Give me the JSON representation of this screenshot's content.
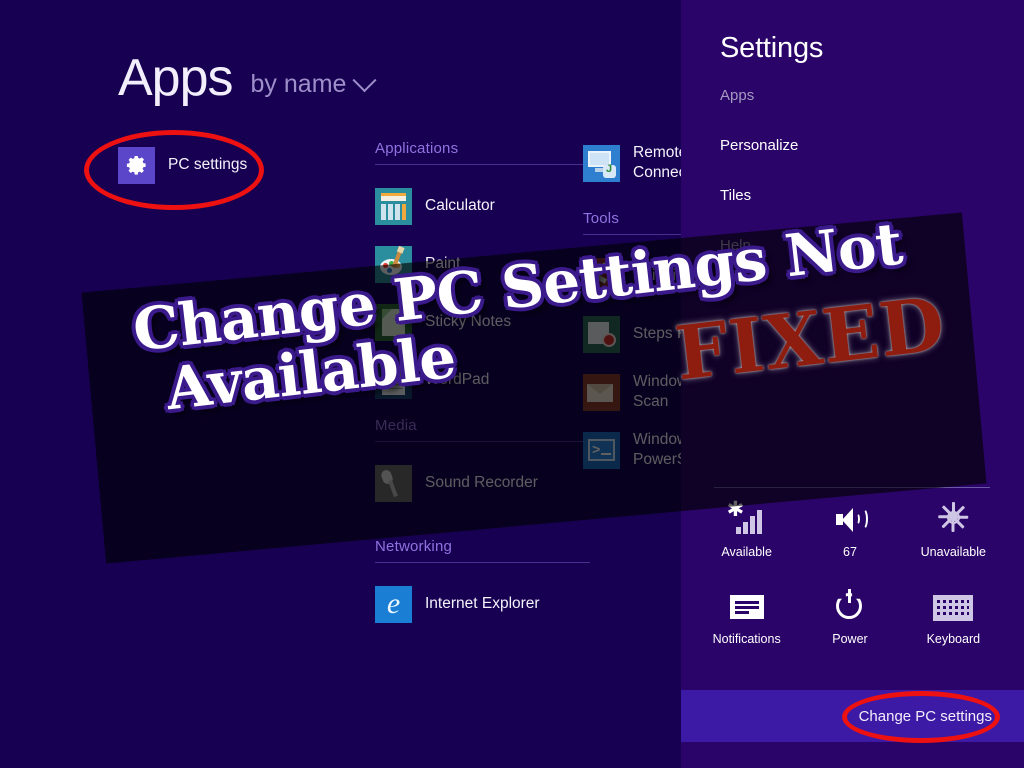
{
  "apps_screen": {
    "title": "Apps",
    "sort_label": "by name",
    "sort_icon": "chevron-down-icon",
    "pinned": {
      "label": "PC settings",
      "icon": "gear-icon",
      "tile_color": "#5b46c9"
    },
    "columns": [
      {
        "sections": [
          {
            "heading": null,
            "items": []
          }
        ]
      },
      {
        "sections": [
          {
            "heading": "Applications",
            "items": [
              {
                "label": "Calculator",
                "icon": "calculator-icon"
              },
              {
                "label": "Paint",
                "icon": "paint-palette-icon"
              },
              {
                "label": "Sticky Notes",
                "icon": "sticky-note-icon"
              },
              {
                "label": "WordPad",
                "icon": "wordpad-document-icon"
              }
            ]
          },
          {
            "heading": "Media",
            "items": [
              {
                "label": "Sound Recorder",
                "icon": "microphone-icon"
              }
            ]
          },
          {
            "heading": "Networking",
            "items": [
              {
                "label": "Internet Explorer",
                "icon": "internet-explorer-icon"
              }
            ]
          }
        ]
      },
      {
        "sections": [
          {
            "heading": null,
            "items": [
              {
                "label": "Remote Desktop\nConnection",
                "icon": "remote-desktop-icon"
              }
            ]
          },
          {
            "heading": "Tools",
            "items": [
              {
                "label": "Snipping Tool",
                "icon": "snipping-tool-icon"
              },
              {
                "label": "Steps Recorder",
                "icon": "steps-recorder-icon"
              },
              {
                "label": "Windows Fax and\nScan",
                "icon": "fax-scan-icon"
              },
              {
                "label": "Windows\nPowerShell",
                "icon": "powershell-icon"
              }
            ]
          }
        ]
      }
    ]
  },
  "settings_panel": {
    "title": "Settings",
    "links": [
      {
        "label": "Apps",
        "state": "dim"
      },
      {
        "label": "Personalize",
        "state": "bright"
      },
      {
        "label": "Tiles",
        "state": "bright"
      },
      {
        "label": "Help",
        "state": "dim"
      }
    ],
    "quick_settings": [
      {
        "label": "Available",
        "icon": "wifi-signal-icon"
      },
      {
        "label": "67",
        "icon": "volume-speaker-icon"
      },
      {
        "label": "Unavailable",
        "icon": "brightness-sun-icon"
      },
      {
        "label": "Notifications",
        "icon": "notifications-icon"
      },
      {
        "label": "Power",
        "icon": "power-icon"
      },
      {
        "label": "Keyboard",
        "icon": "keyboard-icon"
      }
    ],
    "change_pc_settings": "Change PC settings"
  },
  "annotations": {
    "ellipse_color": "#ee1111",
    "ellipses": [
      {
        "target": "PC settings"
      },
      {
        "target": "Change PC settings"
      }
    ],
    "watermark": {
      "line1": "Change PC Settings Not",
      "line2": "Available",
      "stamp": "FIXED",
      "text_color": "#ffffff",
      "outline_color": "#3b1a8c",
      "stamp_color": "#8e1d10"
    }
  },
  "colors": {
    "background": "#170052",
    "settings_panel": "#2a0468",
    "change_bar": "#3d1aa5",
    "section_heading": "#8e74e0",
    "accent_red": "#ee1111"
  }
}
